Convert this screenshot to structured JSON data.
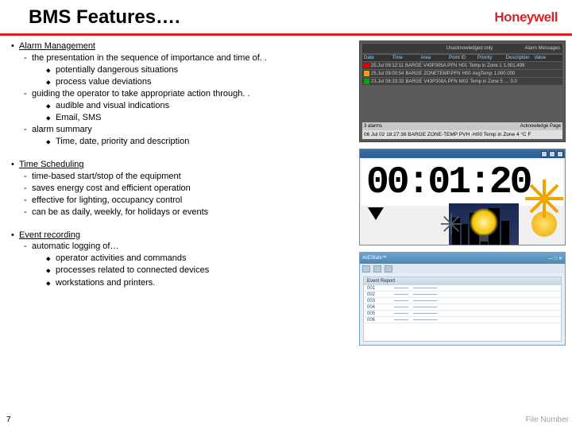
{
  "header": {
    "title": "BMS Features….",
    "brand": "Honeywell"
  },
  "sections": [
    {
      "title": "Alarm Management",
      "subs": [
        {
          "text": "the presentation in the sequence of importance and time of. .",
          "items": [
            "potentially dangerous situations",
            "process value deviations"
          ]
        },
        {
          "text": "guiding the operator to take appropriate action through. .",
          "items": [
            "audible and visual indications",
            "Email, SMS"
          ]
        },
        {
          "text": "alarm summary",
          "items": [
            "Time, date, priority and description"
          ]
        }
      ]
    },
    {
      "title": "Time Scheduling",
      "subs": [
        {
          "text": "time-based start/stop of the equipment"
        },
        {
          "text": "saves energy cost and efficient operation"
        },
        {
          "text": "effective for lighting, occupancy control"
        },
        {
          "text": "can be as daily, weekly, for holidays or events"
        }
      ]
    },
    {
      "title": "Event recording",
      "subs": [
        {
          "text": "automatic logging  of…",
          "items": [
            "operator activities and commands",
            "processes related to connected devices",
            "workstations and printers."
          ]
        }
      ]
    }
  ],
  "alarm_panel": {
    "tab": "Unacknowledged only",
    "menu": "Alarm Messages",
    "cols": [
      "",
      "Date",
      "Time",
      "Area",
      "Point ID",
      "Priority",
      "Description",
      "Value"
    ],
    "rows": [
      [
        "25.Jul",
        "09:12:11",
        "BARGE",
        "V43P305A.PFN",
        "H01",
        "Temp in Zone 1",
        "1.001.499"
      ],
      [
        "25.Jul",
        "09:00:54",
        "BARGE",
        "ZONETEMP.PFN",
        "H00",
        "AvgTemp",
        "1.000.000"
      ],
      [
        "23.Jul",
        "08:33:33",
        "BARGE",
        "V43P308A.PFN",
        "M02",
        "Temp in Zone 5 …",
        "0.0"
      ]
    ],
    "footer_left": "3 alarms",
    "footer_right": "Acknowledge Page",
    "caption": "06 Jul 02  18:27:38  BARGE  ZONE-TEMP PVH   -H00 Temp in Zone 4   °C F"
  },
  "scheduler": {
    "digits": "00:01:20"
  },
  "event_panel": {
    "app": "AcEStats™",
    "title": "Event Report",
    "rows": [
      [
        "001",
        "———",
        "—————"
      ],
      [
        "002",
        "———",
        "—————"
      ],
      [
        "003",
        "———",
        "—————"
      ],
      [
        "004",
        "———",
        "—————"
      ],
      [
        "005",
        "———",
        "—————"
      ],
      [
        "006",
        "———",
        "—————"
      ]
    ]
  },
  "footer": {
    "page": "7",
    "file": "File Number"
  }
}
